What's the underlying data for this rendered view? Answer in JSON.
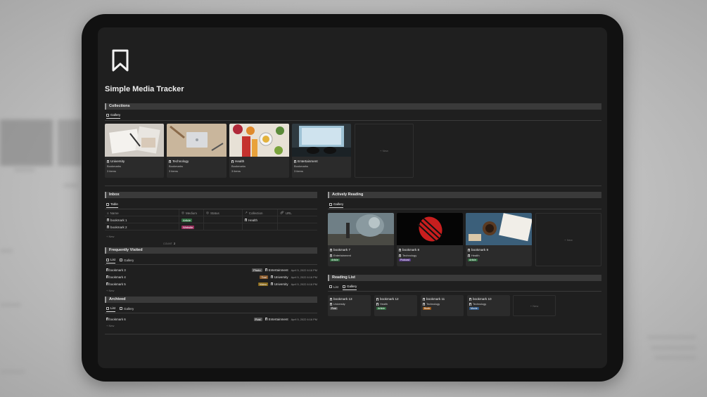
{
  "colors": {
    "tag_article": "#2f6b3f",
    "tag_website": "#9a2f5e",
    "tag_podcast": "#5a3d8a",
    "tag_photo": "#555555",
    "tag_tool": "#8a5a2b",
    "tag_video": "#8a6a1c",
    "tag_post": "#555555",
    "tag_book": "#9a5a1c",
    "tag_movie": "#2f5a8a"
  },
  "title": "Simple Media Tracker",
  "collections": {
    "heading": "Collections",
    "tabs": [
      "Gallery"
    ],
    "cards": [
      {
        "title": "University",
        "label": "Bookmarks",
        "count": "3 items"
      },
      {
        "title": "Technology",
        "label": "Bookmarks",
        "count": "3 items"
      },
      {
        "title": "Health",
        "label": "Bookmarks",
        "count": "3 items"
      },
      {
        "title": "Entertainment",
        "label": "Bookmarks",
        "count": "3 items"
      }
    ],
    "new_label": "+ New"
  },
  "inbox": {
    "heading": "Inbox",
    "tabs": [
      "Table"
    ],
    "columns": [
      "Name",
      "Medium",
      "Status",
      "Collection",
      "URL"
    ],
    "rows": [
      {
        "name": "bookmark 1",
        "medium": "Article",
        "collection": "Health"
      },
      {
        "name": "bookmark 2",
        "medium": "Website",
        "collection": ""
      }
    ],
    "new_label": "+ New",
    "count_label": "COUNT",
    "count_value": "2"
  },
  "frequently_visited": {
    "heading": "Frequently Visited",
    "tabs": [
      "List",
      "Gallery"
    ],
    "rows": [
      {
        "name": "bookmark 3",
        "tag": "Photo",
        "collection": "Entertainment",
        "date": "April 5, 2022 6:16 PM"
      },
      {
        "name": "bookmark 4",
        "tag": "Tool",
        "collection": "University",
        "date": "April 5, 2022 6:16 PM"
      },
      {
        "name": "bookmark 5",
        "tag": "Video",
        "collection": "University",
        "date": "April 5, 2022 6:16 PM"
      }
    ],
    "new_label": "+ New"
  },
  "archived": {
    "heading": "Archived",
    "tabs": [
      "List",
      "Gallery"
    ],
    "rows": [
      {
        "name": "bookmark 6",
        "tag": "Post",
        "collection": "Entertainment",
        "date": "April 5, 2022 6:16 PM"
      }
    ],
    "new_label": "+ New"
  },
  "actively_reading": {
    "heading": "Actively Reading",
    "tabs": [
      "Gallery"
    ],
    "cards": [
      {
        "title": "bookmark 7",
        "collection": "Entertainment",
        "tag": "Article"
      },
      {
        "title": "bookmark 8",
        "collection": "Technology",
        "tag": "Podcast"
      },
      {
        "title": "bookmark 9",
        "collection": "Health",
        "tag": "Article"
      }
    ],
    "new_label": "+ New"
  },
  "reading_list": {
    "heading": "Reading List",
    "tabs": [
      "List",
      "Gallery"
    ],
    "cards": [
      {
        "title": "bookmark 13",
        "collection": "University",
        "tag": "Post"
      },
      {
        "title": "bookmark 12",
        "collection": "Health",
        "tag": "Article"
      },
      {
        "title": "bookmark 11",
        "collection": "Technology",
        "tag": "Book"
      },
      {
        "title": "bookmark 10",
        "collection": "Technology",
        "tag": "Movie"
      }
    ],
    "new_label": "+ New"
  }
}
